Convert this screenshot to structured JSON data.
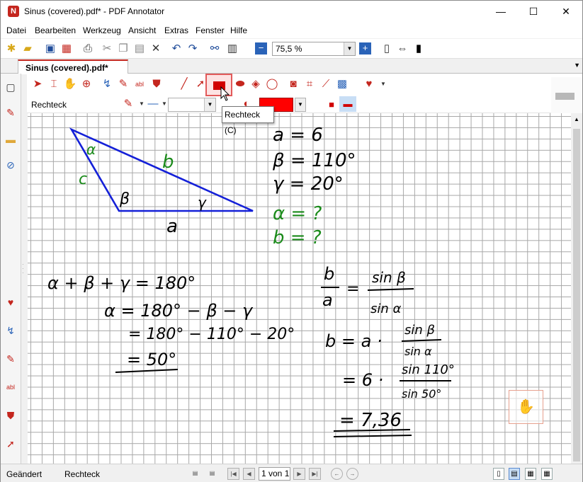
{
  "window": {
    "title": "Sinus (covered).pdf* - PDF Annotator",
    "minimize_label": "—",
    "maximize_label": "☐",
    "close_label": "✕"
  },
  "menu": {
    "items": [
      "Datei",
      "Bearbeiten",
      "Werkzeug",
      "Ansicht",
      "Extras",
      "Fenster",
      "Hilfe"
    ]
  },
  "toolbar": {
    "zoom_value": "75,5 %"
  },
  "tab": {
    "label": "Sinus (covered).pdf*"
  },
  "annotation_toolbar": {
    "current_tool_label": "Rechteck",
    "tooltip": "Rechteck (C)",
    "fill_color": "#ff0000",
    "active_tool_highlight": "#e25a5a"
  },
  "document": {
    "labels": {
      "vertex_alpha": "α",
      "vertex_beta": "β",
      "vertex_gamma": "γ",
      "side_a": "a",
      "side_b": "b",
      "side_c": "c"
    },
    "given": [
      "a = 6",
      "β = 110°",
      "γ = 20°"
    ],
    "unknown": [
      "α = ?",
      "b = ?"
    ],
    "angle_sum_steps": [
      "α + β + γ = 180°",
      "α = 180° − β − γ",
      "= 180° − 110° − 20°",
      "= 50°"
    ],
    "sine_law": {
      "lhs_numerator": "b",
      "lhs_denominator": "a",
      "rhs_numerator": "sin β",
      "rhs_denominator": "sin α"
    },
    "b_steps": {
      "step1_prefix": "b = a ·",
      "step1_numerator": "sin β",
      "step1_denominator": "sin α",
      "step2_prefix": "= 6 ·",
      "step2_numerator": "sin 110°",
      "step2_denominator": "sin 50°",
      "result": "= 7,36"
    },
    "ink_colors": {
      "triangle": "#1420d8",
      "green": "#1a8a1a",
      "black": "#000000"
    }
  },
  "statusbar": {
    "modified": "Geändert",
    "tool": "Rechteck",
    "page_indicator": "1 von 1"
  }
}
